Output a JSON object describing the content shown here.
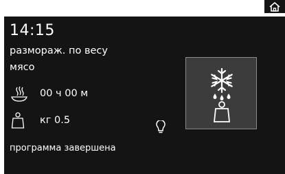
{
  "topbar": {
    "home_icon": "home-icon"
  },
  "panel": {
    "time": "14:15",
    "program": "размораж. по весу",
    "food_category": "мясо",
    "duration": {
      "icon": "steam-dish-icon",
      "value": "00 ч 00 м"
    },
    "weight": {
      "icon": "weight-icon",
      "value": "кг 0.5"
    },
    "light_icon": "light-bulb-icon",
    "status": "программа завершена",
    "mode_tile": {
      "icons": [
        "snowflake-icon",
        "drops-icon",
        "weight-icon"
      ]
    }
  },
  "colors": {
    "background": "#141414",
    "text": "#ffffff",
    "tile": "#3c3c3c",
    "tile_border": "#8a8a8a"
  }
}
